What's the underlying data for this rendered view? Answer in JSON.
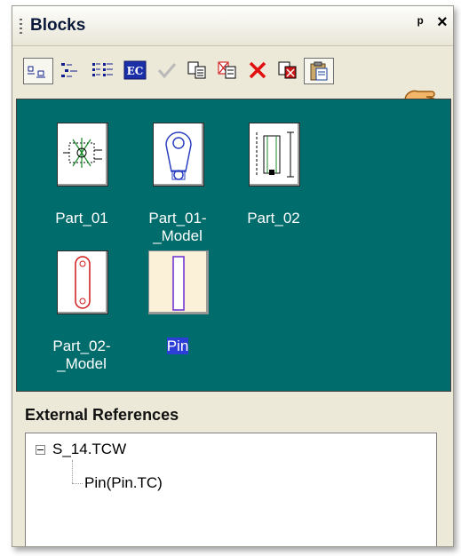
{
  "panel": {
    "title": "Blocks",
    "pin_glyph": "ᵖ",
    "close_glyph": "×"
  },
  "toolbar": {
    "buttons": [
      {
        "name": "large-icons-view-icon"
      },
      {
        "name": "small-icons-view-icon"
      },
      {
        "name": "list-view-icon"
      },
      {
        "name": "edit-component-icon",
        "text": "EC"
      },
      {
        "name": "checkmark-icon"
      },
      {
        "name": "copy-icon"
      },
      {
        "name": "copy-special-icon"
      },
      {
        "name": "delete-icon"
      },
      {
        "name": "paste-block-icon"
      },
      {
        "name": "clipboard-paste-icon"
      }
    ]
  },
  "blocks": [
    {
      "label": "Part_01"
    },
    {
      "label": "Part_01-\n_Model"
    },
    {
      "label": "Part_02"
    },
    {
      "label": "Part_02-\n_Model"
    },
    {
      "label": "Pin",
      "selected": true
    }
  ],
  "external_references": {
    "heading": "External References",
    "root": "S_14.TCW",
    "child": "Pin(Pin.TC)"
  },
  "colors": {
    "view_bg": "#006c6c",
    "selection": "#2b3fd6",
    "delete_red": "#e01010"
  }
}
